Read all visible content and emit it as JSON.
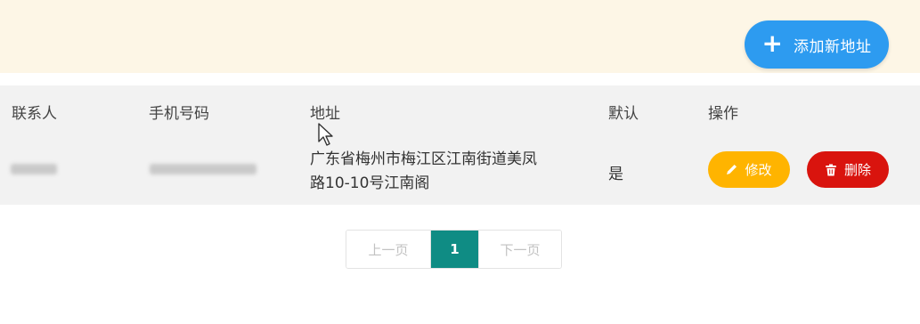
{
  "toolbar": {
    "add_label": "添加新地址",
    "add_icon": "plus-icon",
    "accent": "#2d9bf0"
  },
  "table": {
    "headers": [
      "联系人",
      "手机号码",
      "地址",
      "默认",
      "操作"
    ],
    "rows": [
      {
        "address": "广东省梅州市梅江区江南街道美凤路10-10号江南阁",
        "address_line1": "广东省梅州市梅江区江南街道美凤",
        "address_line2": "路10-10号江南阁",
        "default": "是",
        "edit_label": "修改",
        "edit_icon": "pencil-icon",
        "delete_label": "删除",
        "delete_icon": "trash-icon"
      }
    ]
  },
  "pagination": {
    "prev_label": "上一页",
    "current_page": "1",
    "next_label": "下一页"
  },
  "colors": {
    "edit": "#ffb400",
    "delete": "#d9140e",
    "current_page": "#0f8c84"
  }
}
